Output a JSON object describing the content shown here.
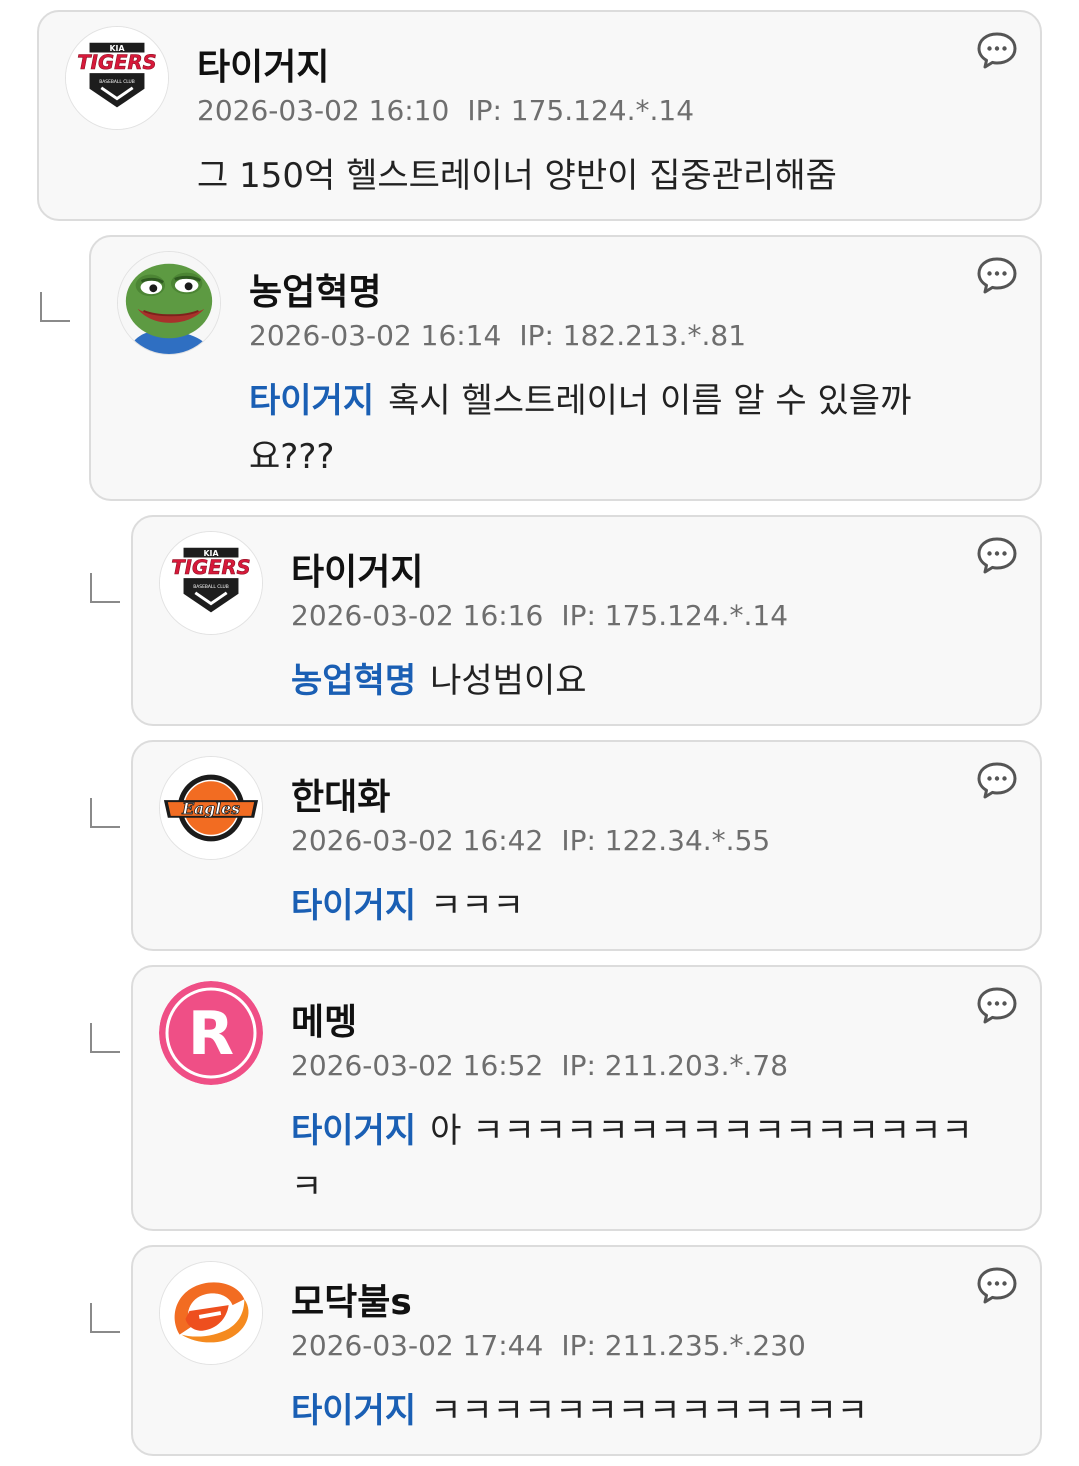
{
  "comments": [
    {
      "nickname": "타이거지",
      "timestamp": "2026-03-02 16:10",
      "ip": "IP: 175.124.*.14",
      "mention": "",
      "text": "그 150억 헬스트레이너 양반이 집중관리해줌",
      "avatar": "tigers-logo"
    },
    {
      "nickname": "농업혁명",
      "timestamp": "2026-03-02 16:14",
      "ip": "IP: 182.213.*.81",
      "mention": "타이거지",
      "text": "혹시 헬스트레이너 이름 알 수 있을까요???",
      "avatar": "pepe-frog"
    },
    {
      "nickname": "타이거지",
      "timestamp": "2026-03-02 16:16",
      "ip": "IP: 175.124.*.14",
      "mention": "농업혁명",
      "text": "나성범이요",
      "avatar": "tigers-logo"
    },
    {
      "nickname": "한대화",
      "timestamp": "2026-03-02 16:42",
      "ip": "IP: 122.34.*.55",
      "mention": "타이거지",
      "text": "ㅋㅋㅋ",
      "avatar": "eagles-logo"
    },
    {
      "nickname": "메멩",
      "timestamp": "2026-03-02 16:52",
      "ip": "IP: 211.203.*.78",
      "mention": "타이거지",
      "text": "아 ㅋㅋㅋㅋㅋㅋㅋㅋㅋㅋㅋㅋㅋㅋㅋㅋ ㅋ",
      "avatar": "r-badge",
      "avatar_letter": "R"
    },
    {
      "nickname": "모닥불s",
      "timestamp": "2026-03-02 17:44",
      "ip": "IP: 211.235.*.230",
      "mention": "타이거지",
      "text": "ㅋㅋㅋㅋㅋㅋㅋㅋㅋㅋㅋㅋㅋㅋ",
      "avatar": "e-swirl-logo"
    }
  ],
  "icons": {
    "reply": "speech-bubble-icon",
    "reply_indicator": "reply-arrow-icon"
  },
  "colors": {
    "mention": "#1a5fb4",
    "card_background": "#f8f8f8",
    "card_border": "#dcdcdc",
    "meta_text": "#6e6e6e",
    "tigers_red": "#d7193a",
    "eagles_orange": "#f26c22",
    "r_badge_pink": "#ef4f86"
  }
}
